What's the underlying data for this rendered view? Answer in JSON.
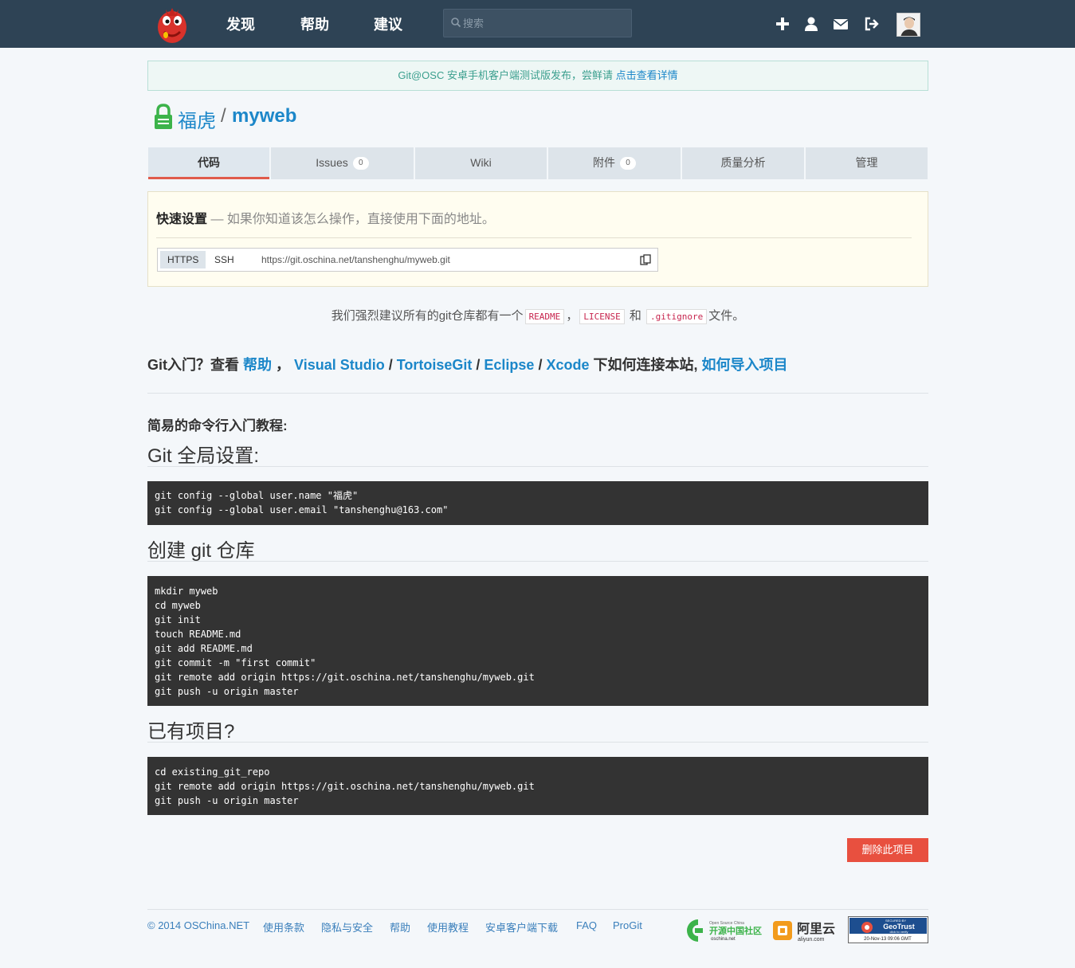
{
  "nav": {
    "links": [
      "发现",
      "帮助",
      "建议"
    ],
    "search_placeholder": "搜索"
  },
  "notice": {
    "text": "Git@OSC 安卓手机客户端测试版发布，尝鲜请 ",
    "link": "点击查看详情"
  },
  "repo": {
    "owner": "福虎",
    "separator": "/",
    "name": "myweb"
  },
  "tabs": [
    {
      "label": "代码",
      "count": null
    },
    {
      "label": "Issues",
      "count": "0"
    },
    {
      "label": "Wiki",
      "count": null
    },
    {
      "label": "附件",
      "count": "0"
    },
    {
      "label": "质量分析",
      "count": null
    },
    {
      "label": "管理",
      "count": null
    }
  ],
  "quick_setup": {
    "title": "快速设置",
    "hint": " — 如果你知道该怎么操作，直接使用下面的地址。",
    "protocols": [
      "HTTPS",
      "SSH"
    ],
    "clone_url": "https://git.oschina.net/tanshenghu/myweb.git"
  },
  "advice": {
    "prefix": "我们强烈建议所有的git仓库都有一个",
    "readme": "README",
    "comma": "，",
    "license": "LICENSE",
    "and": " 和 ",
    "gitignore": ".gitignore",
    "suffix": "文件。"
  },
  "git_intro": {
    "prefix": "Git入门？查看 ",
    "help": "帮助",
    "sep1": " ， ",
    "vs": "Visual Studio",
    "slash": " / ",
    "tortoise": "TortoiseGit",
    "eclipse": "Eclipse",
    "xcode": "Xcode",
    "mid": " 下如何连接本站, ",
    "import": "如何导入项目"
  },
  "tutorial": {
    "subtitle": "简易的命令行入门教程:",
    "global_title": "Git 全局设置:",
    "global_code": [
      "git config --global user.name \"福虎\"",
      "git config --global user.email \"tanshenghu@163.com\""
    ],
    "create_title": "创建 git 仓库",
    "create_code": [
      "mkdir myweb",
      "cd myweb",
      "git init",
      "touch README.md",
      "git add README.md",
      "git commit -m \"first commit\"",
      "git remote add origin https://git.oschina.net/tanshenghu/myweb.git",
      "git push -u origin master"
    ],
    "existing_title": "已有项目?",
    "existing_code": [
      "cd existing_git_repo",
      "git remote add origin https://git.oschina.net/tanshenghu/myweb.git",
      "git push -u origin master"
    ]
  },
  "delete_button": "删除此项目",
  "footer": {
    "copyright": "© 2014 OSChina.NET",
    "links": [
      "使用条款",
      "隐私与安全",
      "帮助",
      "使用教程",
      "安卓客户端下载",
      "FAQ",
      "ProGit"
    ],
    "partners": {
      "oschina_small": "Open Source China",
      "oschina_cn": "开源中国社区",
      "oschina_url": "oschina.net",
      "aliyun_cn": "阿里云",
      "aliyun_url": "aliyun.com",
      "geotrust_top": "SECURED BY",
      "geotrust_brand": "GeoTrust",
      "geotrust_sub": "click to verify",
      "geotrust_date": "20-Nov-13 09:06 GMT"
    }
  },
  "colors": {
    "topbar": "#2e4355",
    "link": "#1c87c9",
    "danger": "#e8503f",
    "tab_active_border": "#e05b4b"
  }
}
